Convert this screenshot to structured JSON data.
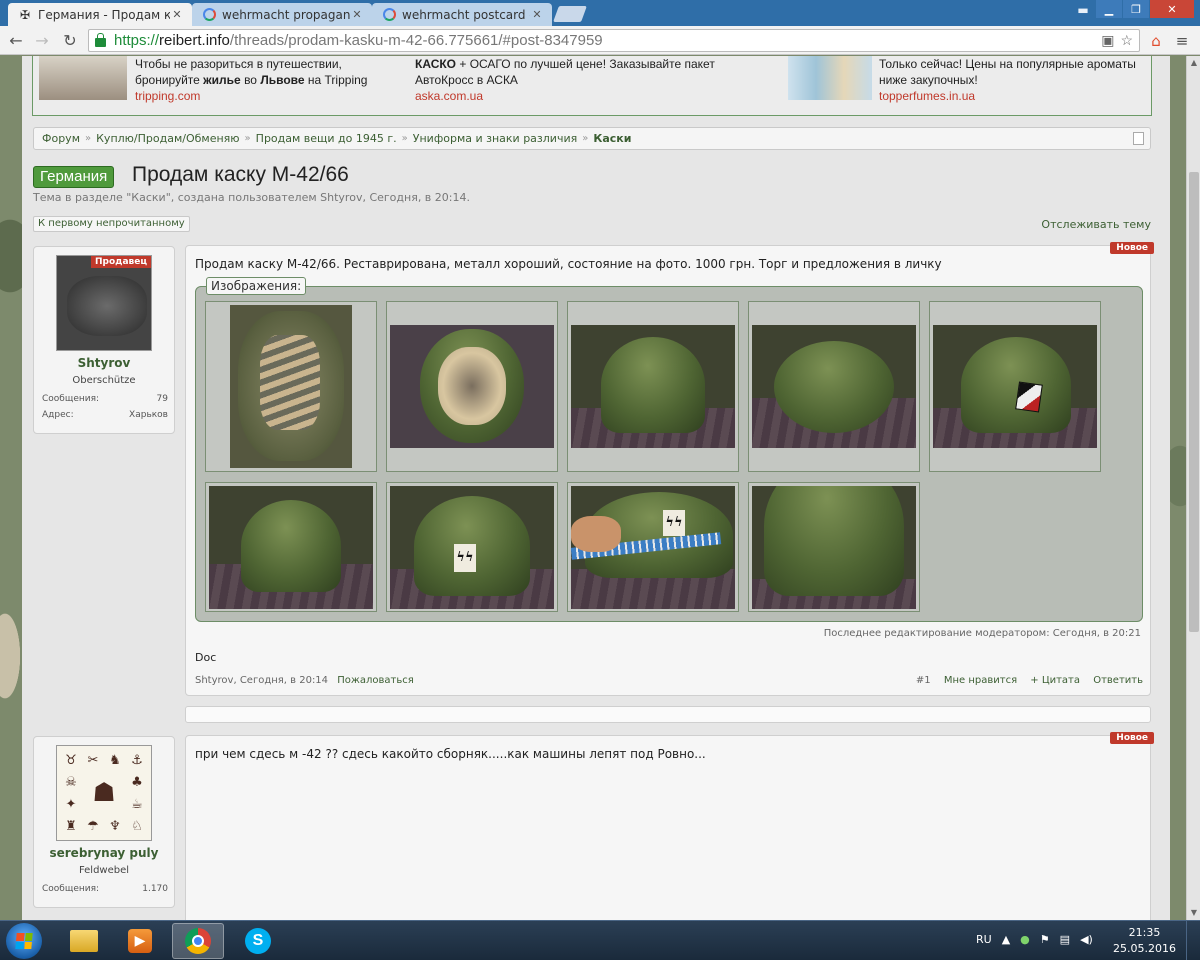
{
  "browser": {
    "tabs": [
      {
        "title": "Германия - Продам каск",
        "active": true,
        "icon": "iron-cross-icon"
      },
      {
        "title": "wehrmacht propaganda p",
        "active": false,
        "icon": "google-icon"
      },
      {
        "title": "wehrmacht postcard - По",
        "active": false,
        "icon": "google-icon"
      }
    ],
    "url": {
      "scheme": "https://",
      "host": "reibert.info",
      "path": "/threads/prodam-kasku-m-42-66.775661/#post-8347959"
    }
  },
  "ads": [
    {
      "line1": "Чтобы не разориться в путешествии,",
      "line2_pre": "бронируйте ",
      "line2_b1": "жилье",
      "line2_mid": " во ",
      "line2_b2": "Львове",
      "line2_post": " на Tripping",
      "link": "tripping.com"
    },
    {
      "line1_b": "КАСКО",
      "line1_rest": " + ОСАГО по лучшей цене! Заказывайте пакет",
      "line2": "АвтоКросс в АСКА",
      "link": "aska.com.ua"
    },
    {
      "line1": "Только сейчас! Цены на популярные ароматы",
      "line2": "ниже закупочных!",
      "link": "topperfumes.in.ua"
    }
  ],
  "breadcrumb": [
    "Форум",
    "Куплю/Продам/Обменяю",
    "Продам вещи до 1945 г.",
    "Униформа и знаки различия",
    "Каски"
  ],
  "thread": {
    "prefix": "Германия",
    "title": "Продам каску М-42/66",
    "description": "Тема в разделе \"Каски\", создана пользователем Shtyrov, Сегодня, в 20:14.",
    "unread_button": "К первому непрочитанному",
    "watch_link": "Отслеживать тему"
  },
  "post1": {
    "user": {
      "ribbon": "Продавец",
      "name": "Shtyrov",
      "rank": "Oberschütze",
      "stats": [
        {
          "label": "Сообщения:",
          "value": "79"
        },
        {
          "label": "Адрес:",
          "value": "Харьков"
        }
      ]
    },
    "badge": "Новое",
    "text": "Продам каску М-42/66. Реставрирована, металл хороший, состояние на фото. 1000 грн. Торг и предложения в личку",
    "gallery_label": "Изображения:",
    "ss_rune": "ϟϟ",
    "edited": "Последнее редактирование модератором: Сегодня, в 20:21",
    "signature": "Doc",
    "meta": {
      "author": "Shtyrov",
      "time": "Сегодня, в 20:14",
      "report": "Пожаловаться",
      "number": "#1",
      "like": "Мне нравится",
      "quote": "+ Цитата",
      "reply": "Ответить"
    }
  },
  "post2": {
    "user": {
      "name": "serebrynay puly",
      "rank": "Feldwebel",
      "stats": [
        {
          "label": "Сообщения:",
          "value": "1.170"
        }
      ]
    },
    "badge": "Новое",
    "text": "при чем сдесь м -42 ?? сдесь какойто сборняк.....как машины лепят под Ровно..."
  },
  "taskbar": {
    "lang": "RU",
    "time": "21:35",
    "date": "25.05.2016"
  }
}
